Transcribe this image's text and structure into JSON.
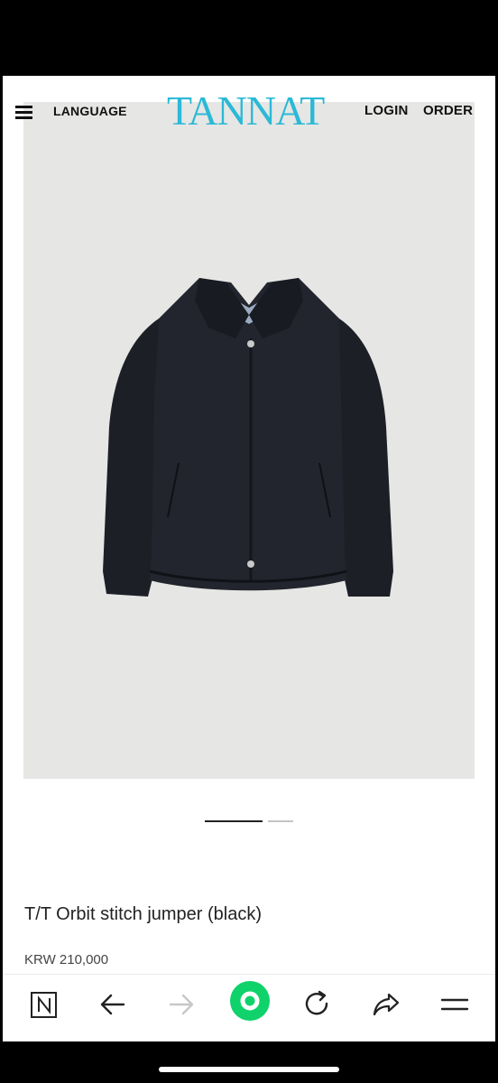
{
  "header": {
    "menu_icon": "hamburger-icon",
    "language_label": "LANGUAGE",
    "logo_text": "TANNAT",
    "login_label": "LOGIN",
    "order_label": "ORDER"
  },
  "product": {
    "title": "T/T Orbit stitch jumper (black)",
    "price": "KRW 210,000",
    "image_subject": "black collared jumper jacket",
    "gallery_current_index": 1,
    "gallery_total": 2
  },
  "browser_toolbar": {
    "icons": [
      "naver-n-icon",
      "back-arrow-icon",
      "forward-arrow-icon",
      "green-home-circle-icon",
      "refresh-icon",
      "share-icon",
      "menu-lines-icon"
    ]
  },
  "colors": {
    "logo": "#2bb9d6",
    "accent_green": "#0fd26a",
    "image_background": "#e6e6e4"
  }
}
